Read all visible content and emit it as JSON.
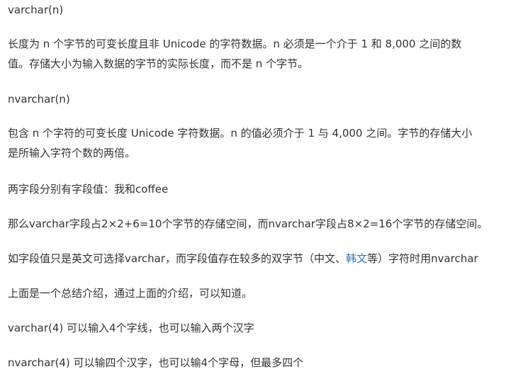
{
  "paragraphs": {
    "p1": "varchar(n)",
    "p2_line1": "长度为 n 个字节的可变长度且非 Unicode 的字符数据。n 必须是一个介于 1 和 8,000 之间的数",
    "p2_line2": "值。存储大小为输入数据的字节的实际长度，而不是 n 个字节。",
    "p3": "nvarchar(n)",
    "p4_line1": "包含 n 个字符的可变长度 Unicode 字符数据。n 的值必须介于 1 与 4,000 之间。字节的存储大小",
    "p4_line2": "是所输入字符个数的两倍。",
    "p5": "两字段分别有字段值：我和coffee",
    "p6": "那么varchar字段占2×2+6=10个字节的存储空间，而nvarchar字段占8×2=16个字节的存储空间。",
    "p7_before": "如字段值只是英文可选择varchar，而字段值存在较多的双字节（中文、",
    "p7_link": "韩文",
    "p7_after": "等）字符时用nvarchar",
    "p8": "上面是一个总结介绍，通过上面的介绍，可以知道。",
    "p9": "varchar(4) 可以输入4个字线，也可以输入两个汉字",
    "p10": "nvarchar(4) 可以输四个汉字，也可以输4个字母，但最多四个"
  },
  "colors": {
    "text": "#333333",
    "link": "#2e74b5",
    "background": "#ffffff"
  }
}
